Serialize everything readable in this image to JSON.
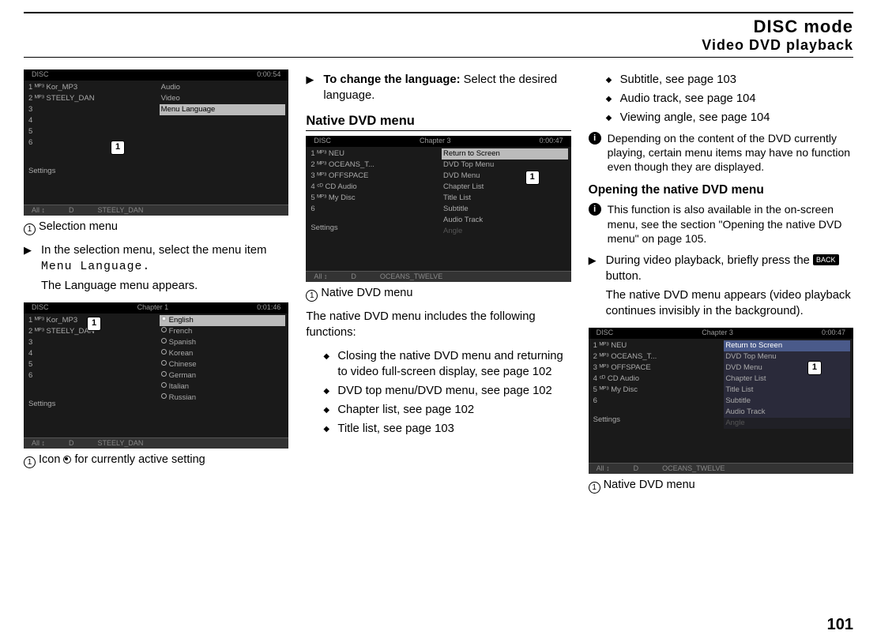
{
  "header": {
    "title": "DISC mode",
    "subtitle": "Video DVD playback"
  },
  "col1": {
    "ss1": {
      "top_left": "DISC",
      "top_right": "0:00:54",
      "left_rows": [
        "1 ᴹᴾ³ Kor_MP3",
        "2 ᴹᴾ³ STEELY_DAN",
        "3",
        "4",
        "5",
        "6"
      ],
      "right_rows": [
        "Audio",
        "Video",
        "Menu Language"
      ],
      "settings": "Settings",
      "bot_l": "All ↕",
      "bot_m": "D",
      "bot_r": "STEELY_DAN",
      "callout": "1"
    },
    "cap1_no": "1",
    "cap1": "Selection menu",
    "tri1": "In the selection menu, select the menu item ",
    "tri1_mono": "Menu Language.",
    "p1": "The Language menu appears.",
    "ss2": {
      "top_left": "DISC",
      "top_mid": "Chapter 1",
      "top_right": "0:01:46",
      "left_rows": [
        "1 ᴹᴾ³ Kor_MP3",
        "2 ᴹᴾ³ STEELY_DAN",
        "3",
        "4",
        "5",
        "6"
      ],
      "right_rows": [
        "English",
        "French",
        "Spanish",
        "Korean",
        "Chinese",
        "German",
        "Italian",
        "Russian"
      ],
      "settings": "Settings",
      "bot_l": "All ↕",
      "bot_m": "D",
      "bot_r": "STEELY_DAN",
      "callout": "1"
    },
    "cap2_no": "1",
    "cap2_a": "Icon ",
    "cap2_b": " for currently active setting"
  },
  "col2": {
    "tri1_bold": "To change the language:",
    "tri1_rest": " Select the desired language.",
    "h1": "Native DVD menu",
    "ss3": {
      "top_left": "DISC",
      "top_mid": "Chapter 3",
      "top_right": "0:00:47",
      "left_rows": [
        "1 ᴹᴾ³ NEU",
        "2 ᴹᴾ³ OCEANS_T...",
        "3 ᴹᴾ³ OFFSPACE",
        "4 ᶜᴰ CD Audio",
        "5 ᴹᴾ³ My Disc",
        "6"
      ],
      "right_rows": [
        "Return to Screen",
        "DVD Top Menu",
        "DVD Menu",
        "Chapter List",
        "Title List",
        "Subtitle",
        "Audio Track",
        "Angle"
      ],
      "settings": "Settings",
      "bot_l": "All ↕",
      "bot_m": "D",
      "bot_r": "OCEANS_TWELVE",
      "callout": "1"
    },
    "cap3_no": "1",
    "cap3": "Native DVD menu",
    "p1": "The native DVD menu includes the following functions:",
    "b1": "Closing the native DVD menu and returning to video full-screen display, see page 102",
    "b2": "DVD top menu/DVD menu, see page 102",
    "b3": "Chapter list, see page 102",
    "b4": "Title list, see page 103"
  },
  "col3": {
    "b1": "Subtitle, see page 103",
    "b2": "Audio track, see page 104",
    "b3": "Viewing angle, see page 104",
    "info1": "Depending on the content of the DVD currently playing, certain menu items may have no function even though they are displayed.",
    "h1": "Opening the native DVD menu",
    "info2": "This function is also available in the on-screen menu, see the section \"Opening the native DVD menu\" on page 105.",
    "tri1_a": "During video playback, briefly press the ",
    "tri1_btn": "BACK",
    "tri1_b": " button.",
    "p1": "The native DVD menu appears (video playback continues invisibly in the background).",
    "ss4": {
      "top_left": "DISC",
      "top_mid": "Chapter 3",
      "top_right": "0:00:47",
      "left_rows": [
        "1 ᴹᴾ³ NEU",
        "2 ᴹᴾ³ OCEANS_T...",
        "3 ᴹᴾ³ OFFSPACE",
        "4 ᶜᴰ CD Audio",
        "5 ᴹᴾ³ My Disc",
        "6"
      ],
      "right_rows": [
        "Return to Screen",
        "DVD Top Menu",
        "DVD Menu",
        "Chapter List",
        "Title List",
        "Subtitle",
        "Audio Track",
        "Angle"
      ],
      "settings": "Settings",
      "bot_l": "All ↕",
      "bot_m": "D",
      "bot_r": "OCEANS_TWELVE",
      "callout": "1"
    },
    "cap4_no": "1",
    "cap4": "Native DVD menu"
  },
  "pagenum": "101"
}
